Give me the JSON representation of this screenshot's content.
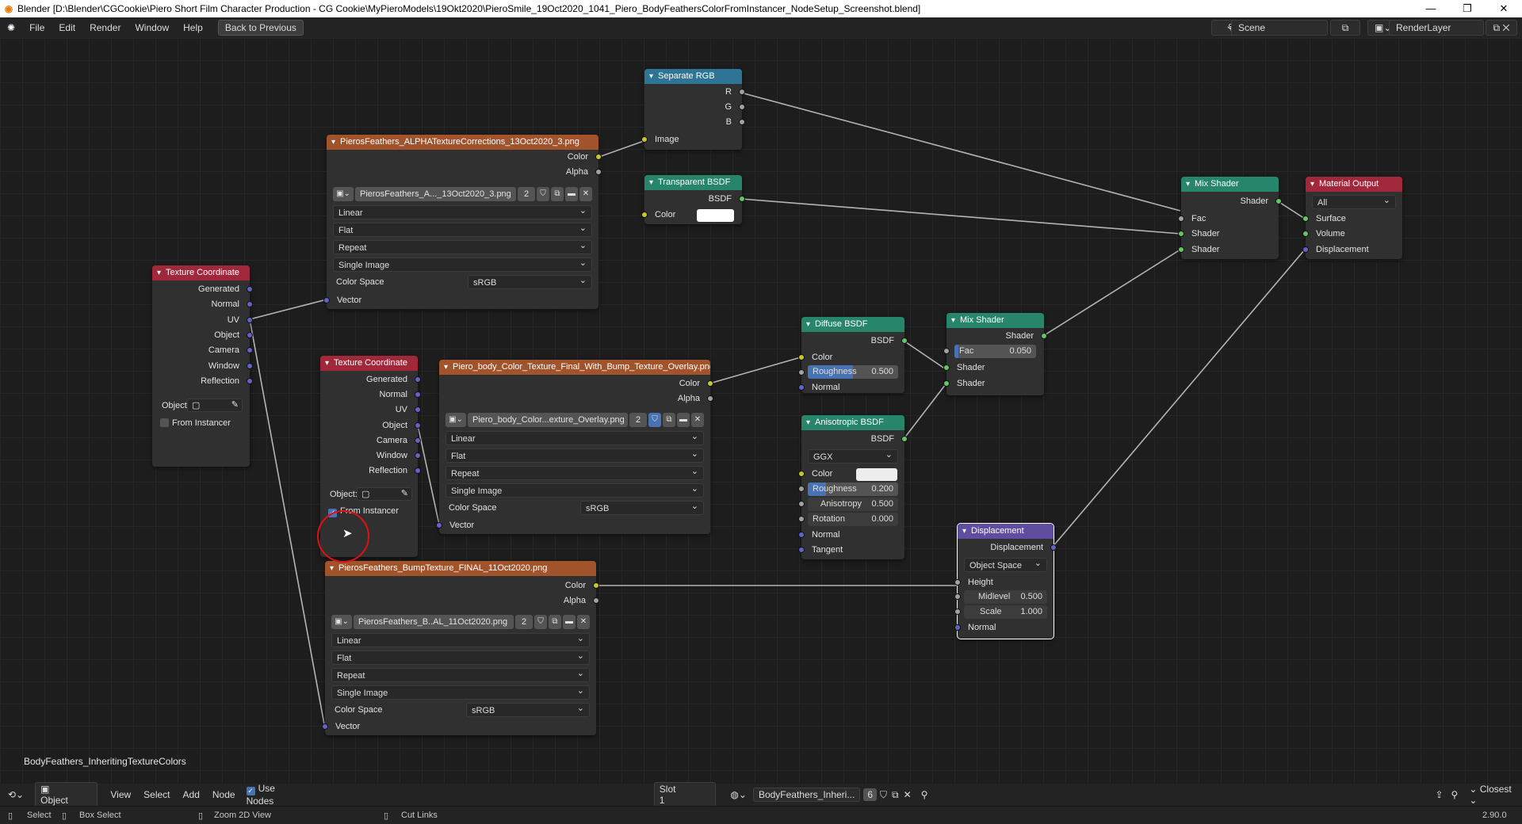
{
  "window": {
    "title": "Blender [D:\\Blender\\CGCookie\\Piero Short Film Character Production - CG Cookie\\MyPieroModels\\19Okt2020\\PieroSmile_19Oct2020_1041_Piero_BodyFeathersColorFromInstancer_NodeSetup_Screenshot.blend]",
    "min": "—",
    "restore": "❐",
    "close": "✕"
  },
  "menu": {
    "file": "File",
    "edit": "Edit",
    "render": "Render",
    "window": "Window",
    "help": "Help",
    "back": "Back to Previous",
    "scene": "Scene",
    "renderlayer": "RenderLayer"
  },
  "nodes": {
    "alpha_tex": {
      "title": "PierosFeathers_ALPHATextureCorrections_13Oct2020_3.png",
      "color": "Color",
      "alpha": "Alpha",
      "image": "PierosFeathers_A..._13Oct2020_3.png",
      "users": "2",
      "interp": "Linear",
      "proj": "Flat",
      "ext": "Repeat",
      "source": "Single Image",
      "cs_label": "Color Space",
      "cs": "sRGB",
      "vector": "Vector"
    },
    "sep_rgb": {
      "title": "Separate RGB",
      "r": "R",
      "g": "G",
      "b": "B",
      "image": "Image"
    },
    "transparent": {
      "title": "Transparent BSDF",
      "bsdf": "BSDF",
      "color": "Color"
    },
    "mix1": {
      "title": "Mix Shader",
      "shader_out": "Shader",
      "fac": "Fac",
      "shader1": "Shader",
      "shader2": "Shader"
    },
    "output": {
      "title": "Material Output",
      "target": "All",
      "surface": "Surface",
      "volume": "Volume",
      "displacement": "Displacement"
    },
    "texco1": {
      "title": "Texture Coordinate",
      "generated": "Generated",
      "normal": "Normal",
      "uv": "UV",
      "object": "Object",
      "camera": "Camera",
      "window": "Window",
      "reflection": "Reflection",
      "obj_label": "Object:",
      "from_instancer": "From Instancer"
    },
    "texco2": {
      "title": "Texture Coordinate",
      "generated": "Generated",
      "normal": "Normal",
      "uv": "UV",
      "object": "Object",
      "camera": "Camera",
      "window": "Window",
      "reflection": "Reflection",
      "obj_label": "Object:",
      "from_instancer": "From Instancer"
    },
    "body_tex": {
      "title": "Piero_body_Color_Texture_Final_With_Bump_Texture_Overlay.png",
      "color": "Color",
      "alpha": "Alpha",
      "image": "Piero_body_Color...exture_Overlay.png",
      "users": "2",
      "interp": "Linear",
      "proj": "Flat",
      "ext": "Repeat",
      "source": "Single Image",
      "cs_label": "Color Space",
      "cs": "sRGB",
      "vector": "Vector"
    },
    "diffuse": {
      "title": "Diffuse BSDF",
      "bsdf": "BSDF",
      "color": "Color",
      "roughness_label": "Roughness",
      "roughness": "0.500",
      "normal": "Normal"
    },
    "mix2": {
      "title": "Mix Shader",
      "shader_out": "Shader",
      "fac_label": "Fac",
      "fac": "0.050",
      "shader1": "Shader",
      "shader2": "Shader"
    },
    "aniso": {
      "title": "Anisotropic BSDF",
      "bsdf": "BSDF",
      "dist": "GGX",
      "color": "Color",
      "roughness_label": "Roughness",
      "roughness": "0.200",
      "anisotropy_label": "Anisotropy",
      "anisotropy": "0.500",
      "rotation_label": "Rotation",
      "rotation": "0.000",
      "normal": "Normal",
      "tangent": "Tangent"
    },
    "displacement": {
      "title": "Displacement",
      "displacement": "Displacement",
      "space": "Object Space",
      "height": "Height",
      "midlevel_label": "Midlevel",
      "midlevel": "0.500",
      "scale_label": "Scale",
      "scale": "1.000",
      "normal": "Normal"
    },
    "bump_tex": {
      "title": "PierosFeathers_BumpTexture_FINAL_11Oct2020.png",
      "color": "Color",
      "alpha": "Alpha",
      "image": "PierosFeathers_B..AL_11Oct2020.png",
      "users": "2",
      "interp": "Linear",
      "proj": "Flat",
      "ext": "Repeat",
      "source": "Single Image",
      "cs_label": "Color Space",
      "cs": "sRGB",
      "vector": "Vector"
    }
  },
  "material_name": "BodyFeathers_InheritingTextureColors",
  "header2": {
    "mode": "Object",
    "view": "View",
    "select": "Select",
    "add": "Add",
    "node": "Node",
    "use_nodes": "Use Nodes",
    "slot": "Slot 1",
    "material": "BodyFeathers_Inheri...",
    "mat_users": "6",
    "snap": "Closest"
  },
  "status": {
    "select": "Select",
    "box_select": "Box Select",
    "zoom": "Zoom 2D View",
    "cut": "Cut Links",
    "version": "2.90.0"
  },
  "colors": {
    "texture": "#a1532c",
    "input": "#a1283b",
    "converter": "#2e7494",
    "shader": "#27856c",
    "output": "#a1283b",
    "vector": "#5f4ea0",
    "socket_color": "#c7c729",
    "socket_float": "#a1a1a1",
    "socket_vector": "#6363c7",
    "socket_shader": "#63c763",
    "selection": "#4772b3"
  },
  "ratios": {
    "diffuse_roughness": 0.5,
    "mix2_fac": 0.05,
    "aniso_roughness": 0.2,
    "aniso_anisotropy": 0.5
  },
  "icons": [
    "blender-logo-icon",
    "image-icon",
    "shield-icon",
    "duplicate-icon",
    "folder-icon",
    "close-icon",
    "eyedropper-icon",
    "cursor-icon"
  ]
}
